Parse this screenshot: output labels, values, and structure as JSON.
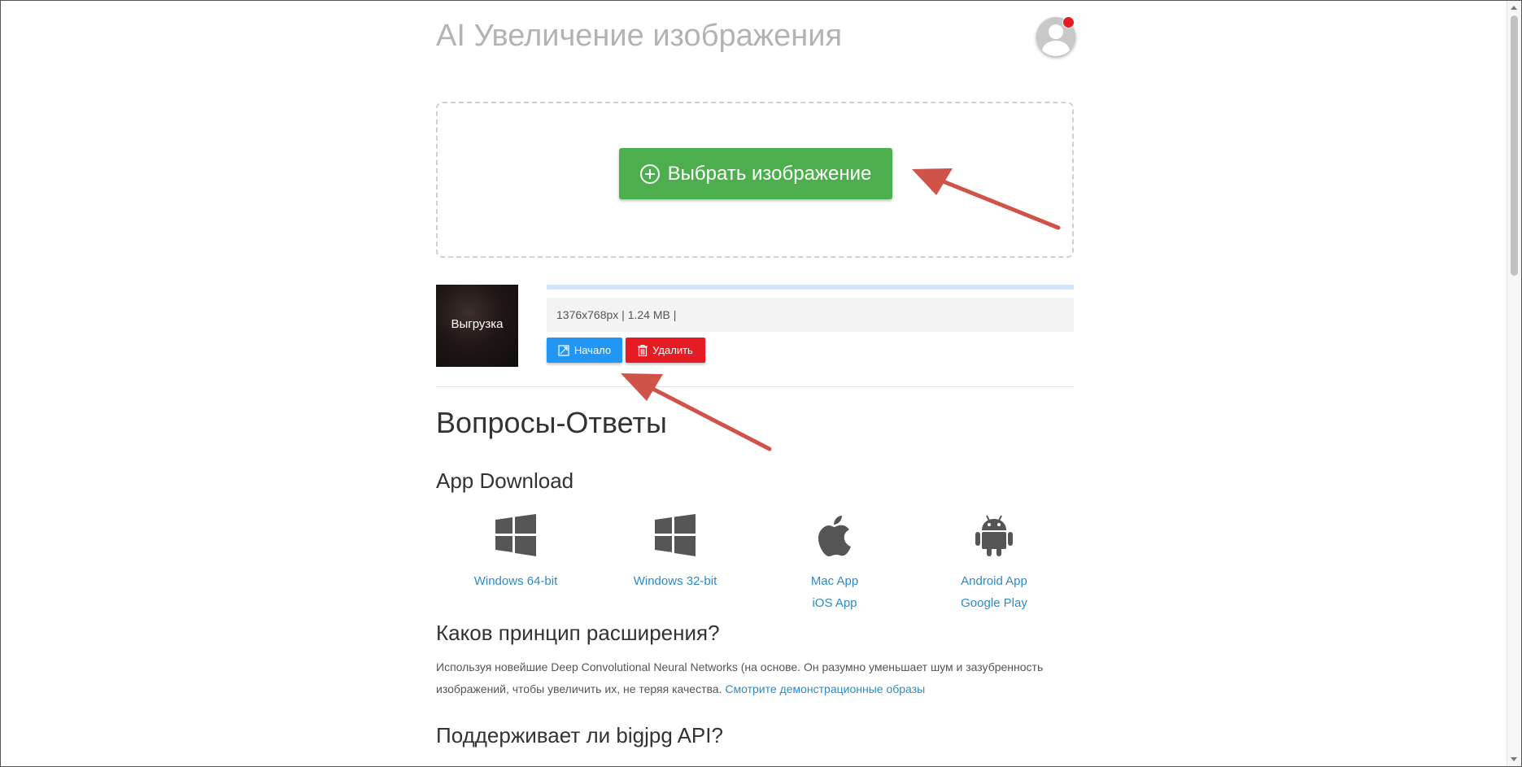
{
  "header": {
    "title": "AI Увеличение изображения"
  },
  "upload": {
    "select_label": "Выбрать изображение"
  },
  "file": {
    "thumb_label": "Выгрузка",
    "info": "1376x768px | 1.24 MB |",
    "progress_fraction": 0.0,
    "start_label": "Начало",
    "delete_label": "Удалить"
  },
  "faq": {
    "title": "Вопросы-Ответы",
    "download_title": "App Download",
    "downloads": [
      {
        "icon": "windows-icon",
        "links": [
          "Windows 64-bit"
        ]
      },
      {
        "icon": "windows-icon",
        "links": [
          "Windows 32-bit"
        ]
      },
      {
        "icon": "apple-icon",
        "links": [
          "Mac App",
          "iOS App"
        ]
      },
      {
        "icon": "android-icon",
        "links": [
          "Android App",
          "Google Play"
        ]
      }
    ],
    "q1": "Каков принцип расширения?",
    "a1_text": "Используя новейшие Deep Convolutional Neural Networks (на основе. Он разумно уменьшает шум и зазубренность изображений, чтобы увеличить их, не теряя качества.",
    "a1_link": "Смотрите демонстрационные образы",
    "q2": "Поддерживает ли bigjpg API?"
  },
  "colors": {
    "green": "#4cae4c",
    "blue": "#2196f3",
    "red": "#e51c23",
    "link": "#2a8bc9",
    "annotation_arrow": "#d0534a"
  }
}
